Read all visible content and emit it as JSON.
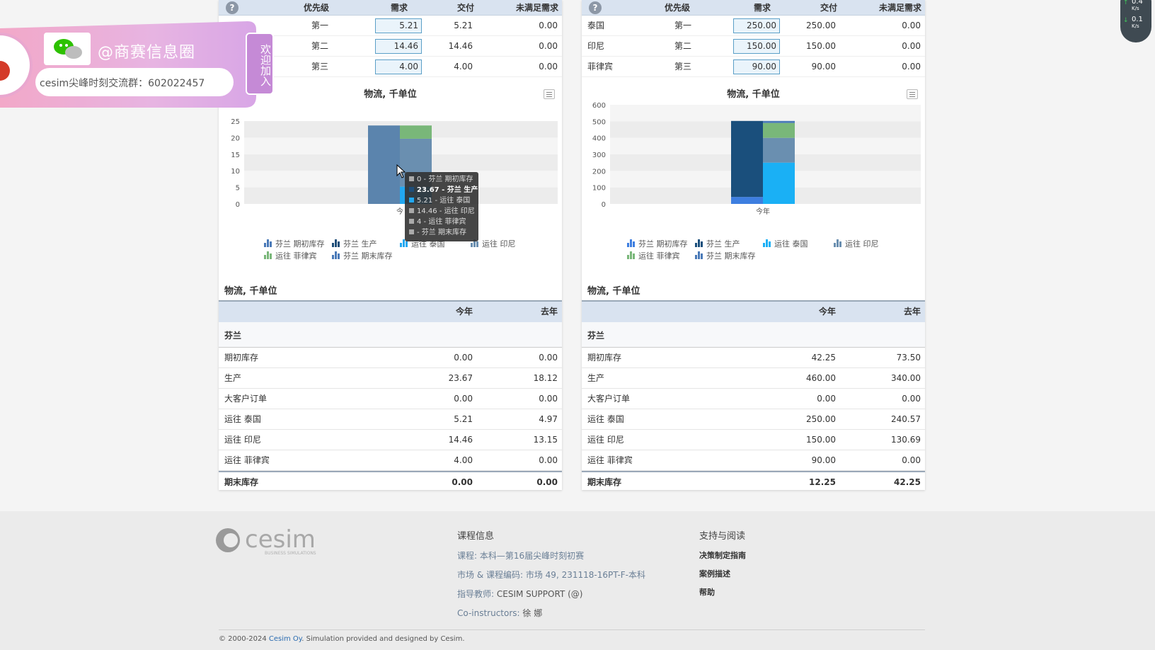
{
  "demand_table": {
    "columns": [
      "优先级",
      "需求",
      "交付",
      "未满足需求"
    ],
    "help": "?"
  },
  "left_panel": {
    "rows": [
      {
        "market": "",
        "priority": "第一",
        "demand": "5.21",
        "delivered": "5.21",
        "unmet": "0.00"
      },
      {
        "market": "",
        "priority": "第二",
        "demand": "14.46",
        "delivered": "14.46",
        "unmet": "0.00"
      },
      {
        "market": "",
        "priority": "第三",
        "demand": "4.00",
        "delivered": "4.00",
        "unmet": "0.00"
      }
    ],
    "chart_title": "物流, 千单位",
    "table_title": "物流, 千单位",
    "table_header": [
      "今年",
      "去年"
    ],
    "group": "芬兰",
    "table_rows": [
      {
        "label": "期初库存",
        "this_year": "0.00",
        "last_year": "0.00"
      },
      {
        "label": "生产",
        "this_year": "23.67",
        "last_year": "18.12"
      },
      {
        "label": "大客户订单",
        "this_year": "0.00",
        "last_year": "0.00"
      },
      {
        "label": "运往 泰国",
        "this_year": "5.21",
        "last_year": "4.97"
      },
      {
        "label": "运往 印尼",
        "this_year": "14.46",
        "last_year": "13.15"
      },
      {
        "label": "运往 菲律宾",
        "this_year": "4.00",
        "last_year": "0.00"
      }
    ],
    "total": {
      "label": "期末库存",
      "this_year": "0.00",
      "last_year": "0.00"
    }
  },
  "right_panel": {
    "rows": [
      {
        "market": "泰国",
        "priority": "第一",
        "demand": "250.00",
        "delivered": "250.00",
        "unmet": "0.00"
      },
      {
        "market": "印尼",
        "priority": "第二",
        "demand": "150.00",
        "delivered": "150.00",
        "unmet": "0.00"
      },
      {
        "market": "菲律宾",
        "priority": "第三",
        "demand": "90.00",
        "delivered": "90.00",
        "unmet": "0.00"
      }
    ],
    "chart_title": "物流, 千单位",
    "table_title": "物流, 千单位",
    "table_header": [
      "今年",
      "去年"
    ],
    "group": "芬兰",
    "table_rows": [
      {
        "label": "期初库存",
        "this_year": "42.25",
        "last_year": "73.50"
      },
      {
        "label": "生产",
        "this_year": "460.00",
        "last_year": "340.00"
      },
      {
        "label": "大客户订单",
        "this_year": "0.00",
        "last_year": "0.00"
      },
      {
        "label": "运往 泰国",
        "this_year": "250.00",
        "last_year": "240.57"
      },
      {
        "label": "运往 印尼",
        "this_year": "150.00",
        "last_year": "130.69"
      },
      {
        "label": "运往 菲律宾",
        "this_year": "90.00",
        "last_year": "0.00"
      }
    ],
    "total": {
      "label": "期末库存",
      "this_year": "12.25",
      "last_year": "42.25"
    }
  },
  "chart_data": [
    {
      "type": "bar",
      "stacked": true,
      "title": "物流, 千单位",
      "categories": [
        "今年"
      ],
      "ylim": [
        0,
        25
      ],
      "yticks": [
        0,
        5,
        10,
        15,
        20,
        25
      ],
      "sources": [
        {
          "name": "芬兰 期初库存",
          "value": 0,
          "color": "#4a7ab8"
        },
        {
          "name": "芬兰 生产",
          "value": 23.67,
          "color": "#1f4e79"
        }
      ],
      "uses": [
        {
          "name": "运往 泰国",
          "value": 5.21,
          "color": "#22a7f0"
        },
        {
          "name": "运往 印尼",
          "value": 14.46,
          "color": "#6a8fb0"
        },
        {
          "name": "运往 菲律宾",
          "value": 4.0,
          "color": "#79b779"
        },
        {
          "name": "芬兰 期末库存",
          "value": 0,
          "color": "#4a7ab8"
        }
      ],
      "legend": [
        "芬兰 期初库存",
        "芬兰 生产",
        "运往 泰国",
        "运往 印尼",
        "运往 菲律宾",
        "芬兰 期末库存"
      ],
      "highlight_color": "#5b84ad"
    },
    {
      "type": "bar",
      "stacked": true,
      "title": "物流, 千单位",
      "categories": [
        "今年"
      ],
      "ylim": [
        0,
        600
      ],
      "yticks": [
        0,
        100,
        200,
        300,
        400,
        500,
        600
      ],
      "sources": [
        {
          "name": "芬兰 期初库存",
          "value": 42.25,
          "color": "#3d7ee0"
        },
        {
          "name": "芬兰 生产",
          "value": 460,
          "color": "#1a4f7c"
        }
      ],
      "uses": [
        {
          "name": "运往 泰国",
          "value": 250,
          "color": "#1ab0f5"
        },
        {
          "name": "运往 印尼",
          "value": 150,
          "color": "#6a8fb0"
        },
        {
          "name": "运往 菲律宾",
          "value": 90,
          "color": "#79b779"
        },
        {
          "name": "芬兰 期末库存",
          "value": 12.25,
          "color": "#4a7ab8"
        }
      ],
      "legend": [
        "芬兰 期初库存",
        "芬兰 生产",
        "运往 泰国",
        "运往 印尼",
        "运往 菲律宾",
        "芬兰 期末库存"
      ]
    }
  ],
  "tooltip": {
    "lines": [
      "0 - 芬兰 期初库存",
      "23.67 - 芬兰 生产",
      "5.21 - 运往 泰国",
      "14.46 - 运往 印尼",
      "4 - 运往 菲律宾",
      "- 芬兰 期末库存"
    ],
    "partial_axis_label": "今"
  },
  "banner": {
    "handle": "@商赛信息圈",
    "group_text": "cesim尖峰时刻交流群：602022457",
    "join_text": "欢迎加入"
  },
  "speed": {
    "up": "0.4",
    "up_unit": "K/s",
    "down": "0.1",
    "down_unit": "K/s"
  },
  "footer": {
    "logo": "cesim",
    "logo_sub": "BUSINESS SIMULATIONS",
    "course_heading": "课程信息",
    "course_label": "课程:",
    "course_value": "本科—第16届尖峰时刻初赛",
    "market_label": "市场 & 课程编码:",
    "market_value": "市场 49, 231118-16PT-F-本科",
    "instructor_label": "指导教师:",
    "instructor_value": "CESIM SUPPORT (@)",
    "coinst_label": "Co-instructors:",
    "coinst_value": "徐 娜",
    "support_heading": "支持与阅读",
    "links": [
      "决策制定指南",
      "案例描述",
      "帮助"
    ],
    "copyright_prefix": "© 2000-2024",
    "copyright_link": "Cesim Oy",
    "copyright_suffix": ". Simulation provided and designed by Cesim."
  }
}
